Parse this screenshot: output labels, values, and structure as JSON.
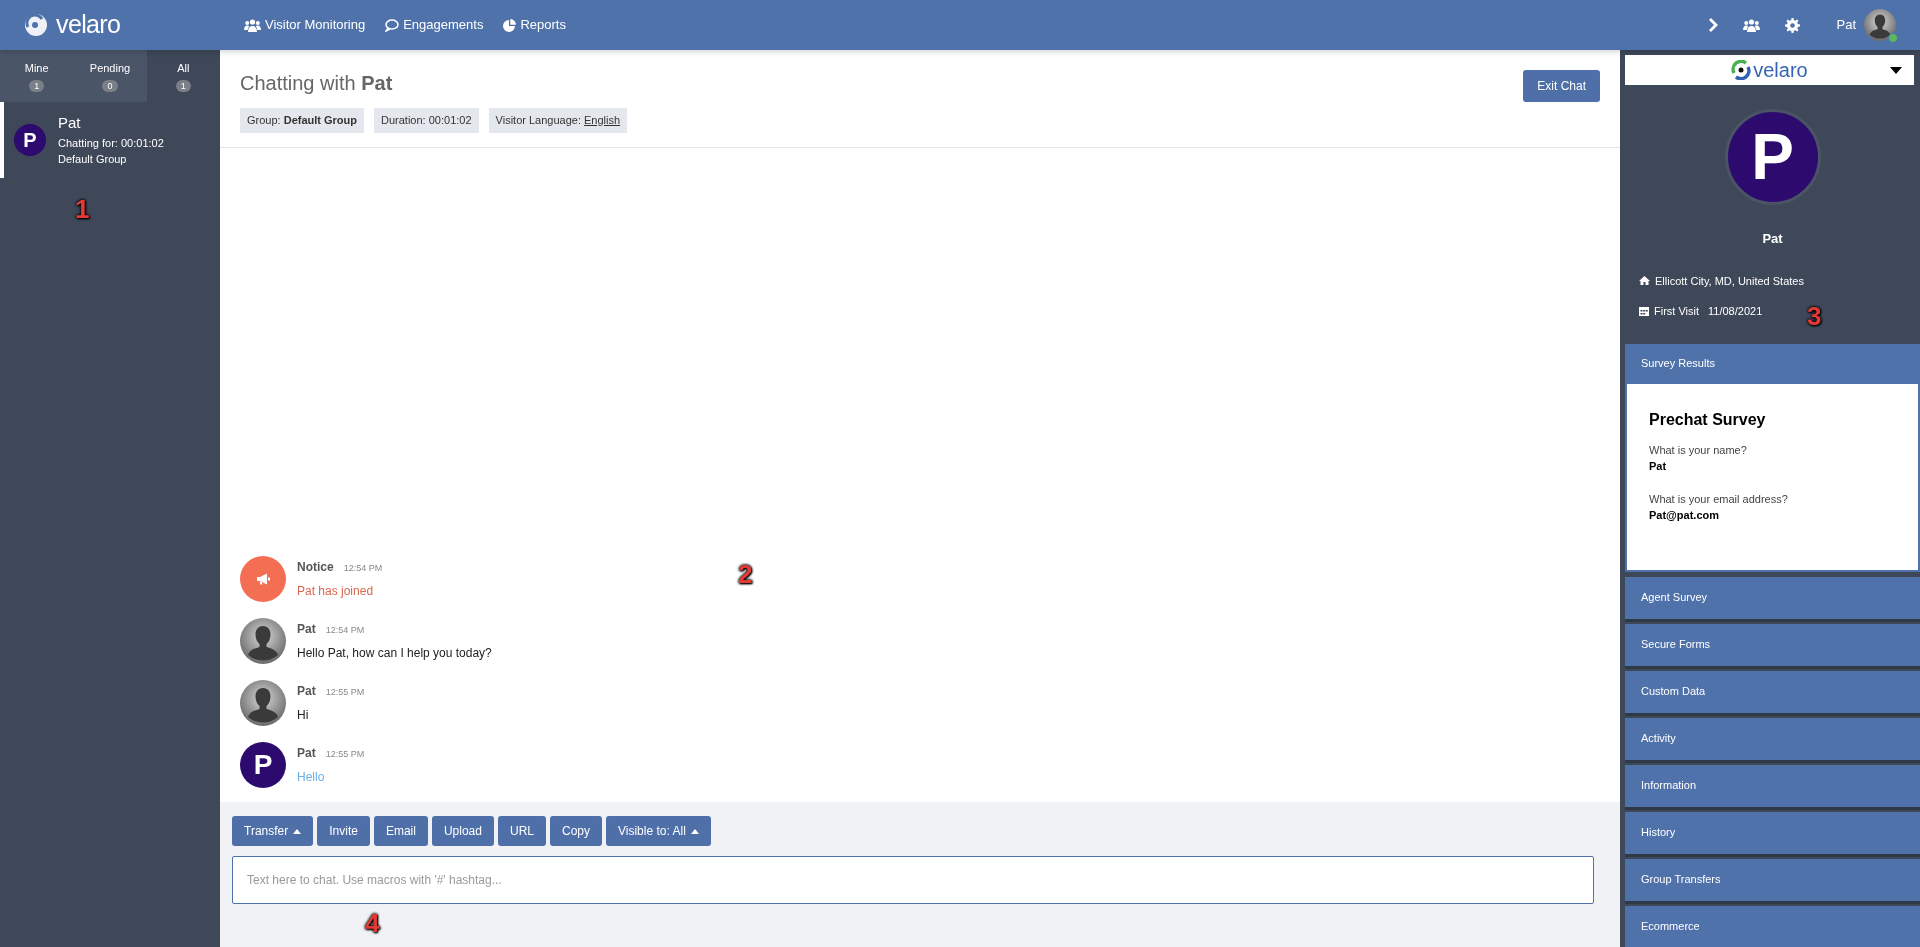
{
  "topbar": {
    "logo": "velaro",
    "nav": [
      {
        "kind": "users",
        "label": "Visitor Monitoring"
      },
      {
        "kind": "comment",
        "label": "Engagements"
      },
      {
        "kind": "pie",
        "label": "Reports"
      }
    ],
    "user": "Pat",
    "online": true
  },
  "left": {
    "tabs": [
      {
        "label": "Mine",
        "count": "1",
        "selected": false
      },
      {
        "label": "Pending",
        "count": "0",
        "selected": false
      },
      {
        "label": "All",
        "count": "1",
        "selected": true
      }
    ],
    "chats": [
      {
        "initial": "P",
        "name": "Pat",
        "duration": "Chatting for: 00:01:02",
        "group": "Default Group",
        "selected": true
      }
    ]
  },
  "chat": {
    "title": "Chatting with **Pat**",
    "exit_button": "Exit Chat",
    "tags": [
      {
        "kind": "text",
        "text": "Group: **Default Group**"
      },
      {
        "kind": "text",
        "text": "Duration: 00:01:02"
      },
      {
        "kind": "link",
        "text": "Visitor Language:",
        "link": "English"
      }
    ],
    "messages": [
      {
        "kind": "notice",
        "author": "Notice",
        "time": "12:54 PM",
        "text": "Pat has joined"
      },
      {
        "kind": "agent",
        "author": "Pat",
        "time": "12:54 PM",
        "text": "Hello Pat, how can I help you today?"
      },
      {
        "kind": "agent",
        "author": "Pat",
        "time": "12:55 PM",
        "text": "Hi"
      },
      {
        "kind": "visitor",
        "author": "Pat",
        "time": "12:55 PM",
        "initial": "P",
        "text": "Hello"
      }
    ],
    "toolbar": [
      {
        "label": "Transfer",
        "caret": true
      },
      {
        "label": "Invite",
        "caret": false
      },
      {
        "label": "Email",
        "caret": false
      },
      {
        "label": "Upload",
        "caret": false
      },
      {
        "label": "URL",
        "caret": false
      },
      {
        "label": "Copy",
        "caret": false
      },
      {
        "label": "Visible to: All",
        "caret": true
      }
    ],
    "input": {
      "placeholder": "Text here to chat. Use macros with '#' hashtag..."
    }
  },
  "right": {
    "brand": "velaro",
    "initial": "P",
    "name": "Pat",
    "location": "Ellicott City, MD, United States",
    "first_visit_label": "First Visit",
    "first_visit": "11/08/2021",
    "sections": [
      {
        "label": "Survey Results",
        "expanded": true,
        "card": {
          "title": "Prechat Survey",
          "qa": [
            {
              "q": "What is your name?",
              "a": "Pat"
            },
            {
              "q": "What is your email address?",
              "a": "Pat@pat.com"
            }
          ]
        }
      },
      {
        "label": "Agent Survey",
        "expanded": false
      },
      {
        "label": "Secure Forms",
        "expanded": false
      },
      {
        "label": "Custom Data",
        "expanded": false
      },
      {
        "label": "Activity",
        "expanded": false
      },
      {
        "label": "Information",
        "expanded": false
      },
      {
        "label": "History",
        "expanded": false
      },
      {
        "label": "Group Transfers",
        "expanded": false
      },
      {
        "label": "Ecommerce",
        "expanded": false
      }
    ]
  },
  "callouts": [
    "1",
    "2",
    "3",
    "4"
  ]
}
